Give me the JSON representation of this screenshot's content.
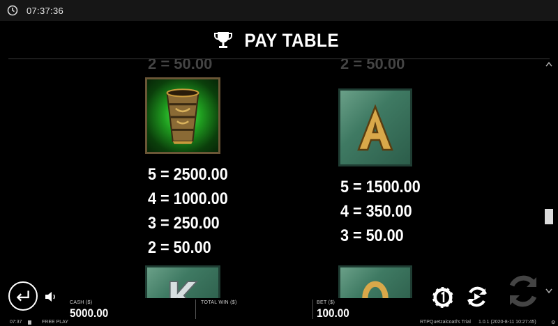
{
  "status_bar": {
    "clock_icon": "clock-icon",
    "time": "07:37:36"
  },
  "header": {
    "icon": "trophy-icon",
    "title": "PAY TABLE"
  },
  "paytable": {
    "partial_top": [
      "2 = 50.00",
      "2 = 50.00"
    ],
    "symbols": [
      {
        "symbol": "cup",
        "icon": "golden-cup-icon",
        "payouts": [
          "5 = 2500.00",
          "4 = 1000.00",
          "3 = 250.00",
          "2 = 50.00"
        ]
      },
      {
        "symbol": "A",
        "icon": "letter-a-icon",
        "payouts": [
          "5 = 1500.00",
          "4 = 350.00",
          "3 = 50.00"
        ]
      }
    ],
    "partial_bottom": [
      {
        "symbol": "K",
        "icon": "letter-k-icon"
      },
      {
        "symbol": "Q",
        "icon": "letter-q-icon"
      }
    ]
  },
  "hud": {
    "cash_label": "CASH ($)",
    "cash_value": "5000.00",
    "total_win_label": "TOTAL WIN ($)",
    "bet_label": "BET ($)",
    "bet_value": "100.00"
  },
  "footer": {
    "time": "07:37",
    "mode": "FREE PLAY",
    "rtp": "RTP",
    "game_title": "Quetzalcoatl's Trial",
    "version": "1.0.1 (2020-8-11 10:27:45)"
  },
  "colors": {
    "background": "#000000",
    "tile_green": "#3f7a63",
    "gold": "#c89a3c",
    "glow_green": "#4cff4c"
  }
}
